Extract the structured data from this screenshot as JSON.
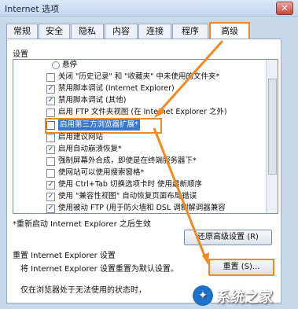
{
  "window": {
    "title": "Internet 选项",
    "close_label": "✕"
  },
  "tabs": [
    {
      "label": "常规"
    },
    {
      "label": "安全"
    },
    {
      "label": "隐私"
    },
    {
      "label": "内容"
    },
    {
      "label": "连接"
    },
    {
      "label": "程序"
    },
    {
      "label": "高级"
    }
  ],
  "active_tab": "高级",
  "settings": {
    "label": "设置",
    "items": [
      {
        "type": "radio",
        "checked": false,
        "label": "悬停"
      },
      {
        "type": "checkbox",
        "checked": false,
        "label": "关闭 \"历史记录\" 和 \"收藏夹\" 中未使用的文件夹*"
      },
      {
        "type": "checkbox",
        "checked": true,
        "label": "禁用脚本调试 (Internet Explorer)"
      },
      {
        "type": "checkbox",
        "checked": true,
        "label": "禁用脚本调试 (其他)"
      },
      {
        "type": "checkbox",
        "checked": false,
        "label": "启用 FTP 文件夹视图 (在 Internet Explorer 之外)"
      },
      {
        "type": "checkbox",
        "checked": false,
        "label": "启用第三方浏览器扩展*",
        "highlighted": true
      },
      {
        "type": "checkbox",
        "checked": false,
        "label": "启用建议网站"
      },
      {
        "type": "checkbox",
        "checked": true,
        "label": "启用自动崩溃恢复*"
      },
      {
        "type": "checkbox",
        "checked": false,
        "label": "强制屏幕外合成，即使是在终端服务器下*"
      },
      {
        "type": "checkbox",
        "checked": false,
        "label": "使网站可以使用搜索窗格*"
      },
      {
        "type": "checkbox",
        "checked": true,
        "label": "使用 Ctrl+Tab 切换选项卡时  使用最新顺序"
      },
      {
        "type": "checkbox",
        "checked": true,
        "label": "使用 \"兼容性视图\" 自动恢复页面布局错误"
      },
      {
        "type": "checkbox",
        "checked": true,
        "label": "使用被动 FTP (用于防火墙和 DSL 调制解调器兼容"
      }
    ],
    "note": "*重新启动 Internet Explorer 之后生效"
  },
  "restore_button": {
    "label": "还原高级设置 (R)"
  },
  "reset_section": {
    "heading": "重置 Internet Explorer 设置",
    "desc": "将 Internet Explorer 设置重置为默认设置。",
    "button_label": "重置 (S)...",
    "footer": "仅在浏览器处于无法使用的状态时，"
  },
  "watermark": {
    "text": "系统之家",
    "icon": "logo-icon"
  },
  "colors": {
    "annotation_orange": "#f08a24",
    "selection_blue": "#3a78d6"
  }
}
